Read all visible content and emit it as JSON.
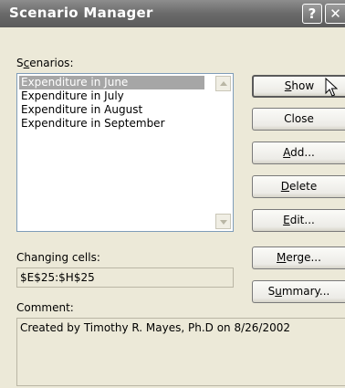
{
  "window": {
    "title": "Scenario Manager",
    "help_label": "?",
    "close_label": "✕"
  },
  "scenarios": {
    "label_pre": "S",
    "label_ul": "c",
    "label_post": "enarios:",
    "items": [
      "Expenditure in June",
      "Expenditure in July",
      "Expenditure in August",
      "Expenditure in September"
    ],
    "selected_index": 0
  },
  "changing_cells": {
    "label": "Changing cells:",
    "value": "$E$25:$H$25"
  },
  "comment": {
    "label": "Comment:",
    "value": "Created by Timothy R. Mayes, Ph.D on 8/26/2002"
  },
  "buttons": {
    "show": {
      "ul": "S",
      "rest": "how"
    },
    "close": {
      "pre": "Close"
    },
    "add": {
      "ul": "A",
      "rest": "dd..."
    },
    "delete": {
      "ul": "D",
      "rest": "elete"
    },
    "edit": {
      "ul": "E",
      "rest": "dit..."
    },
    "merge": {
      "ul": "M",
      "rest": "erge..."
    },
    "summary": {
      "pre": "S",
      "ul": "u",
      "rest": "mmary..."
    }
  }
}
